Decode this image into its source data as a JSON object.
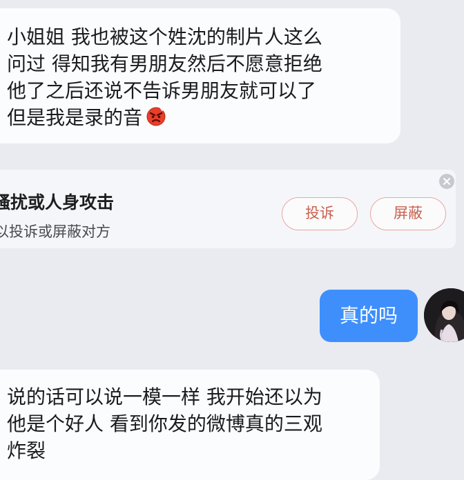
{
  "conversation": {
    "messages": [
      {
        "side": "incoming",
        "lines": [
          "小姐姐 我也被这个姓沈的制片人这么",
          "问过 得知我有男朋友然后不愿意拒绝",
          "他了之后还说不告诉男朋友就可以了",
          "但是我是录的音"
        ],
        "trailing_icon": "angry-face-emoji"
      },
      {
        "side": "outgoing",
        "text": "真的吗"
      },
      {
        "side": "incoming",
        "lines": [
          "说的话可以说一模一样 我开始还以为",
          "他是个好人 看到你发的微博真的三观",
          "炸裂"
        ]
      }
    ]
  },
  "harassment_notice": {
    "title": "骚扰或人身攻击",
    "subtitle": "以投诉或屏蔽对方",
    "report_label": "投诉",
    "block_label": "屏蔽",
    "close_icon": "close-icon"
  },
  "colors": {
    "background": "#e9ebf0",
    "incoming_bubble": "#fbfcfd",
    "outgoing_bubble": "#3e8ffc",
    "action_text": "#c9604f",
    "action_border": "#e8a79f"
  },
  "avatar": {
    "icon": "user-avatar"
  }
}
